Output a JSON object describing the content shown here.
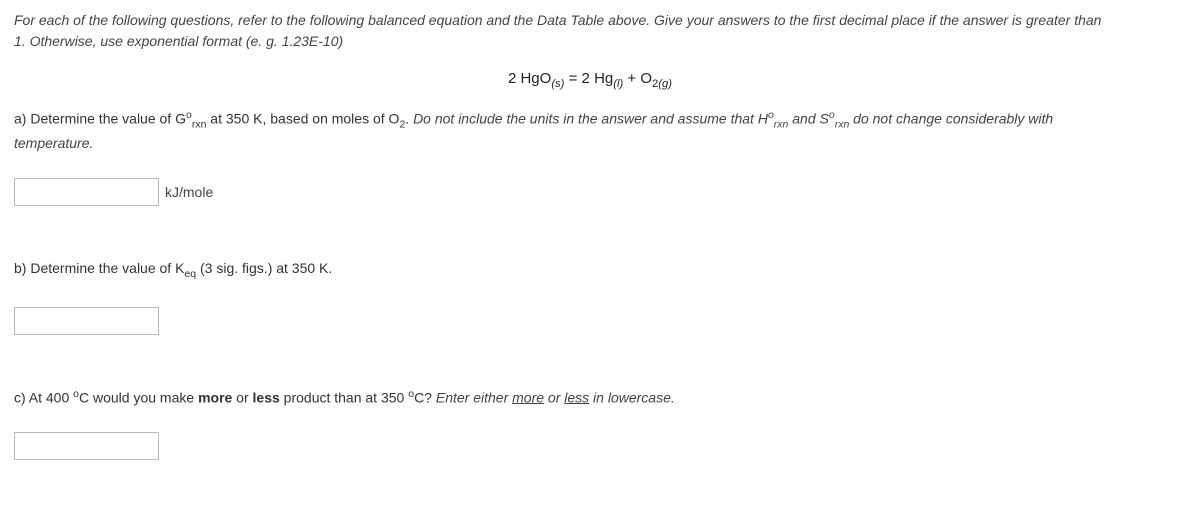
{
  "intro": {
    "line1_part1": "For each of the following questions, refer to the following balanced equation and the Data Table above. Give your answers to the first decimal place if the answer is greater than",
    "line2": "1. Otherwise, use exponential format (e. g. 1.23E-10)"
  },
  "equation": {
    "coeff1": "2",
    "sp1": "HgO",
    "state1": "(s)",
    "eq": "=",
    "coeff2": "2",
    "sp2": "Hg",
    "state2": "(l)",
    "plus": "+",
    "sp3": "O",
    "sub3": "2",
    "state3": "(g)"
  },
  "qa": {
    "prefix": "a) Determine the value of G",
    "sup1": "o",
    "sub1": "rxn",
    "mid1": " at 350 K, based on moles of O",
    "sub2": "2",
    "period1": ". ",
    "italic_part1": "Do not include the units in the answer and assume that H",
    "italic_sup2": "o",
    "italic_sub3": "rxn",
    "italic_mid2": " and S",
    "italic_sup3": "o",
    "italic_sub4": "rxn",
    "italic_part2": " do not change considerably with",
    "italic_line2": "temperature.",
    "unit": "kJ/mole"
  },
  "qb": {
    "prefix": "b) Determine the value of K",
    "sub": "eq",
    "suffix": " (3 sig. figs.) at 350 K."
  },
  "qc": {
    "prefix": "c) At 400 ",
    "deg": "o",
    "c1": "C would you make ",
    "bold1": "more",
    "mid": " or ",
    "bold2": "less",
    "mid2": " product than at 350 ",
    "deg2": "o",
    "c2": "C? ",
    "ital1": "Enter either ",
    "ul1": "more",
    "ital_or": " or ",
    "ul2": "less",
    "ital_end": " in lowercase."
  }
}
